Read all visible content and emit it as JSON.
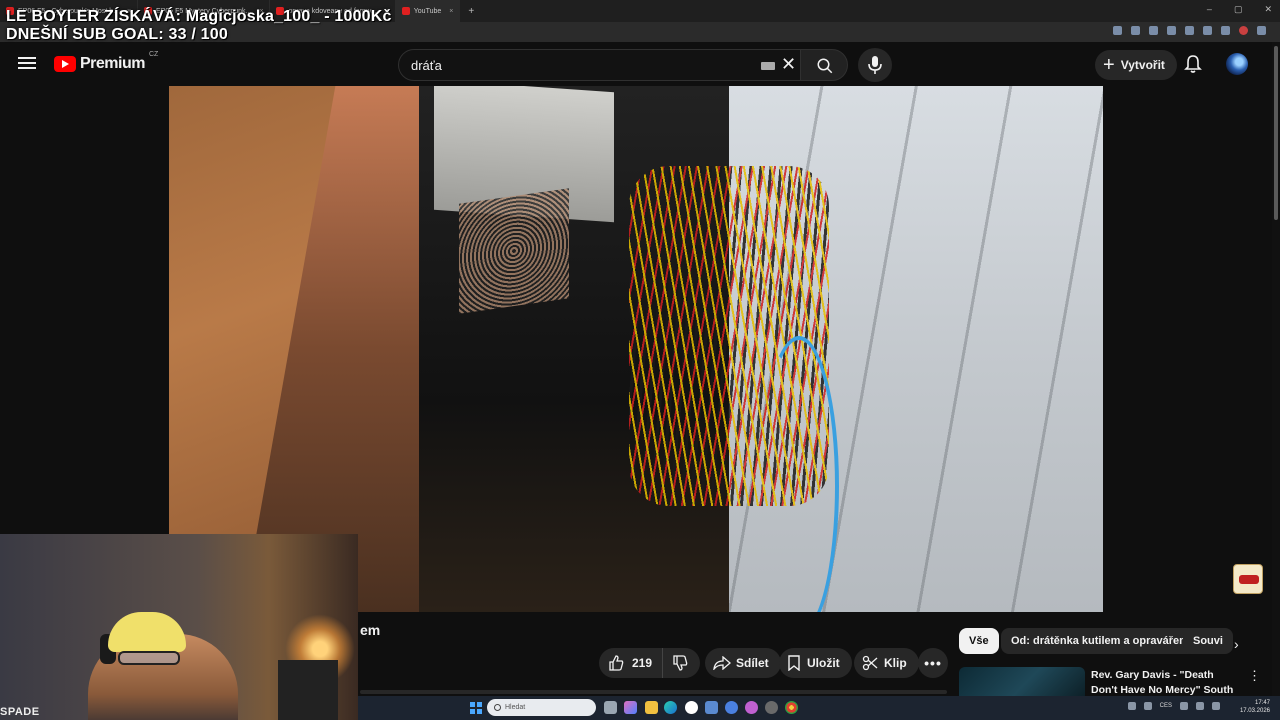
{
  "overlay": {
    "goal_line": "LE BOYLER ZÍSKÁVÁ: Magicjoska_100_ - 1000Kč",
    "sub_goal_line": "DNEŠNÍ SUB GOAL: 33 / 100"
  },
  "browser": {
    "tabs": [
      {
        "label": "EP06 F5 - Cyberpunk's Most b..."
      },
      {
        "label": "EP06 F5 Mystery Cyberpunk..."
      },
      {
        "label": "oprava kdoveanu od farmy..."
      },
      {
        "label": "YouTube"
      }
    ],
    "new_tab_label": "+"
  },
  "youtube": {
    "logo_text": "Premium",
    "country_code": "CZ",
    "search_query": "dráťa",
    "create_label": "Vytvořit",
    "icons": {
      "menu": "menu-icon",
      "search": "search-icon",
      "mic": "mic-icon",
      "bell": "bell-icon",
      "clear": "close-icon",
      "keyboard": "keyboard-icon"
    }
  },
  "video": {
    "title_fragment": "em",
    "likes": "219",
    "share_label": "Sdílet",
    "save_label": "Uložit",
    "clip_label": "Klip",
    "more_label": "•••"
  },
  "webcam": {
    "label": "SPADE"
  },
  "sidebar": {
    "chips": [
      {
        "label": "Vše",
        "selected": true
      },
      {
        "label": "Od: drátěnka kutilem a opravářem",
        "selected": false
      },
      {
        "label": "Souvi",
        "selected": false
      }
    ],
    "next_label": "›",
    "recommendation": {
      "title": "Rev. Gary Davis - \"Death Don't Have No Mercy\" South of ...",
      "menu_label": "⋮"
    }
  },
  "taskbar": {
    "search_placeholder": "Hledat",
    "language": "CES",
    "time": "17:47",
    "date": "17.03.2026"
  },
  "colors": {
    "background": "#0f0f0f",
    "youtube_red": "#ff0000",
    "chip_selected": "#f1f1f1",
    "pill_bg": "#272727"
  }
}
